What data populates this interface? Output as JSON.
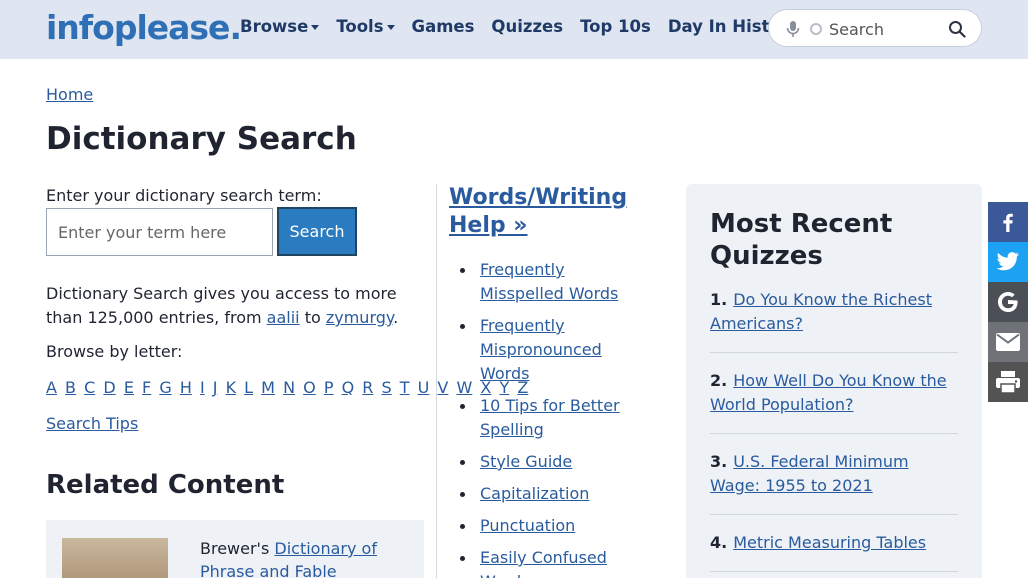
{
  "header": {
    "logo": "infoplease.",
    "nav": [
      {
        "label": "Browse",
        "dropdown": true
      },
      {
        "label": "Tools",
        "dropdown": true
      },
      {
        "label": "Games",
        "dropdown": false
      },
      {
        "label": "Quizzes",
        "dropdown": false
      },
      {
        "label": "Top 10s",
        "dropdown": false
      },
      {
        "label": "Day In History",
        "dropdown": false
      }
    ],
    "search_placeholder": "Search"
  },
  "breadcrumb": "Home",
  "page_title": "Dictionary Search",
  "search": {
    "label": "Enter your dictionary search term:",
    "input_placeholder": "Enter your term here",
    "button_label": "Search"
  },
  "description": {
    "before": "Dictionary Search gives you access to more than 125,000 entries, from ",
    "link1": "aalii",
    "middle": " to ",
    "link2": "zymurgy",
    "after": "."
  },
  "browse_label": "Browse by letter:",
  "letters": [
    "A",
    "B",
    "C",
    "D",
    "E",
    "F",
    "G",
    "H",
    "I",
    "J",
    "K",
    "L",
    "M",
    "N",
    "O",
    "P",
    "Q",
    "R",
    "S",
    "T",
    "U",
    "V",
    "W",
    "X",
    "Y",
    "Z"
  ],
  "search_tips": "Search Tips",
  "related": {
    "title": "Related Content",
    "card_prefix": "Brewer's ",
    "card_link": "Dictionary of Phrase and Fable"
  },
  "help": {
    "title": "Words/Writing Help »",
    "items": [
      "Frequently Misspelled Words",
      "Frequently Mispronounced Words",
      "10 Tips for Better Spelling",
      "Style Guide",
      "Capitalization",
      "Punctuation",
      "Easily Confused Words"
    ]
  },
  "quizzes": {
    "title": "Most Recent Quizzes",
    "items": [
      {
        "num": "1.",
        "label": "Do You Know the Richest Americans?"
      },
      {
        "num": "2.",
        "label": "How Well Do You Know the World Population?"
      },
      {
        "num": "3.",
        "label": "U.S. Federal Minimum Wage: 1955 to 2021"
      },
      {
        "num": "4.",
        "label": "Metric Measuring Tables"
      }
    ]
  },
  "share": [
    "facebook-icon",
    "twitter-icon",
    "google-icon",
    "email-icon",
    "print-icon"
  ],
  "colors": {
    "header_bg": "#dfe6f1",
    "link": "#2a5b9e",
    "button": "#2a7bbf",
    "panel_bg": "#eef1f6",
    "facebook": "#3b5998",
    "twitter": "#1da1f2"
  }
}
